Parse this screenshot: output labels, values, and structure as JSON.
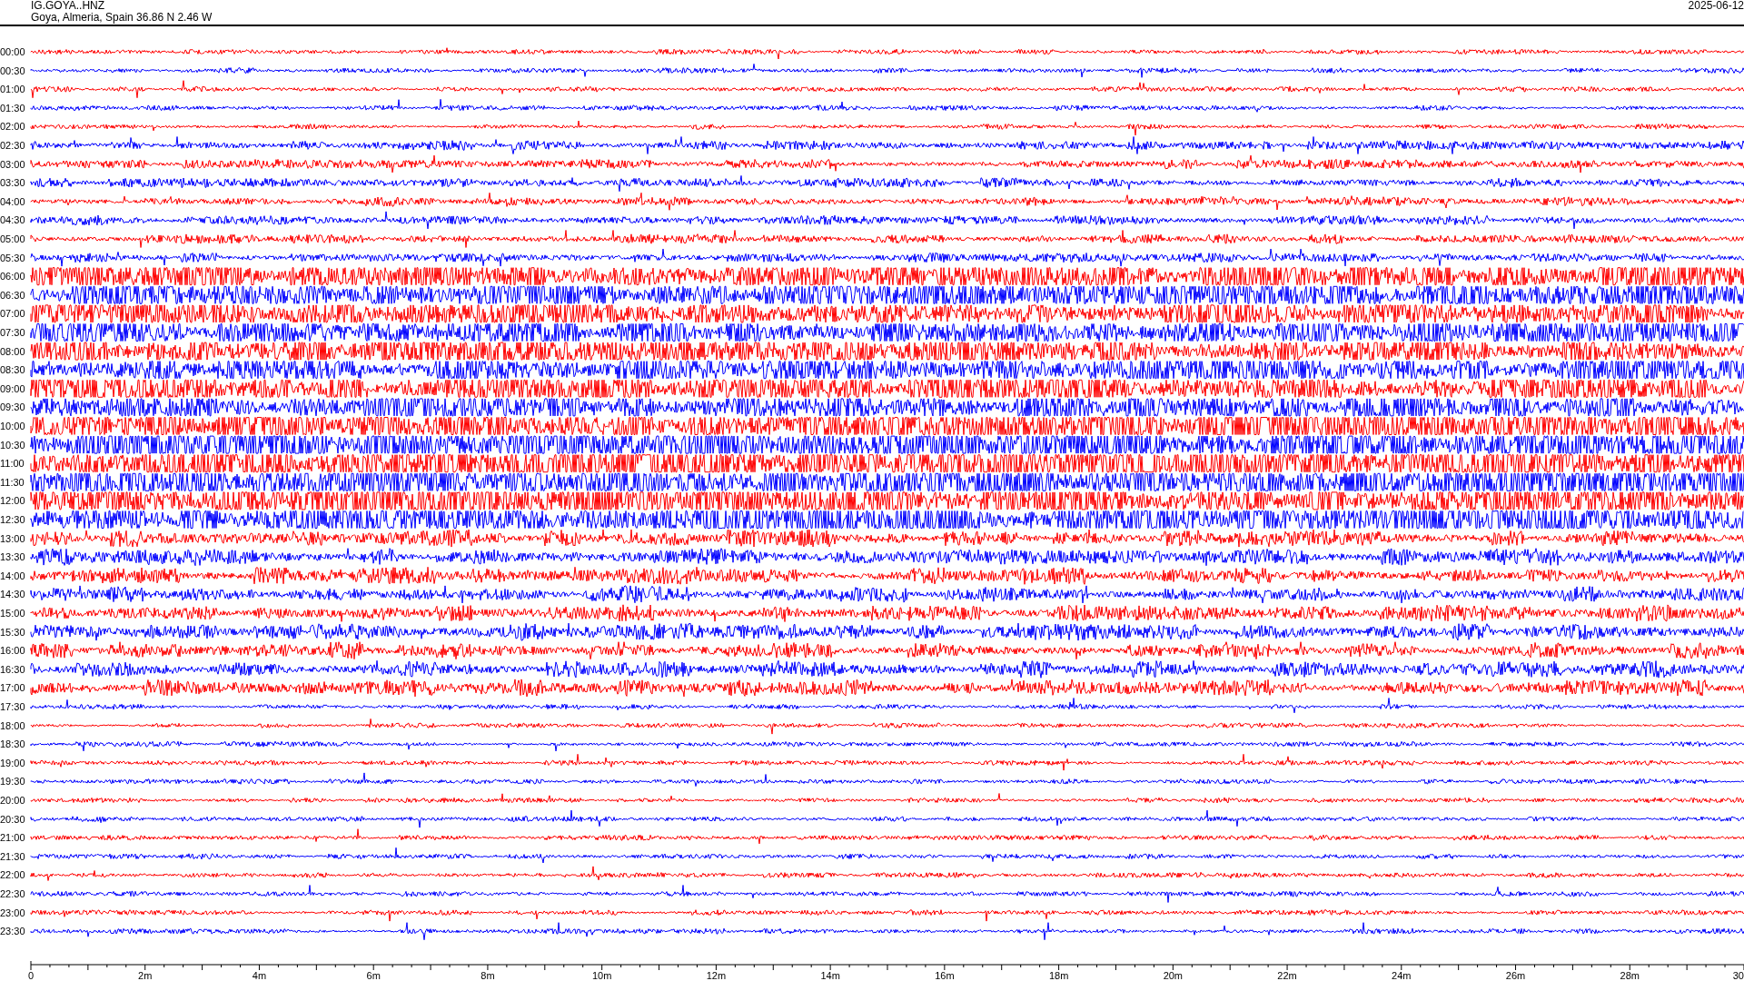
{
  "header": {
    "station": "IG.GOYA..HNZ",
    "location": "Goya, Almeria, Spain  36.86 N 2.46 W",
    "date": "2025-06-12"
  },
  "rows": [
    {
      "time": "00:00",
      "color": "#ff0000"
    },
    {
      "time": "00:30",
      "color": "#0000ff"
    },
    {
      "time": "01:00",
      "color": "#ff0000"
    },
    {
      "time": "01:30",
      "color": "#0000ff"
    },
    {
      "time": "02:00",
      "color": "#ff0000"
    },
    {
      "time": "02:30",
      "color": "#0000ff"
    },
    {
      "time": "03:00",
      "color": "#ff0000"
    },
    {
      "time": "03:30",
      "color": "#0000ff"
    },
    {
      "time": "04:00",
      "color": "#ff0000"
    },
    {
      "time": "04:30",
      "color": "#0000ff"
    },
    {
      "time": "05:00",
      "color": "#ff0000"
    },
    {
      "time": "05:30",
      "color": "#0000ff"
    },
    {
      "time": "06:00",
      "color": "#ff0000"
    },
    {
      "time": "06:30",
      "color": "#0000ff"
    },
    {
      "time": "07:00",
      "color": "#ff0000"
    },
    {
      "time": "07:30",
      "color": "#0000ff"
    },
    {
      "time": "08:00",
      "color": "#ff0000"
    },
    {
      "time": "08:30",
      "color": "#0000ff"
    },
    {
      "time": "09:00",
      "color": "#ff0000"
    },
    {
      "time": "09:30",
      "color": "#0000ff"
    },
    {
      "time": "10:00",
      "color": "#ff0000"
    },
    {
      "time": "10:30",
      "color": "#0000ff"
    },
    {
      "time": "11:00",
      "color": "#ff0000"
    },
    {
      "time": "11:30",
      "color": "#0000ff"
    },
    {
      "time": "12:00",
      "color": "#ff0000"
    },
    {
      "time": "12:30",
      "color": "#0000ff"
    },
    {
      "time": "13:00",
      "color": "#ff0000"
    },
    {
      "time": "13:30",
      "color": "#0000ff"
    },
    {
      "time": "14:00",
      "color": "#ff0000"
    },
    {
      "time": "14:30",
      "color": "#0000ff"
    },
    {
      "time": "15:00",
      "color": "#ff0000"
    },
    {
      "time": "15:30",
      "color": "#0000ff"
    },
    {
      "time": "16:00",
      "color": "#ff0000"
    },
    {
      "time": "16:30",
      "color": "#0000ff"
    },
    {
      "time": "17:00",
      "color": "#ff0000"
    },
    {
      "time": "17:30",
      "color": "#0000ff"
    },
    {
      "time": "18:00",
      "color": "#ff0000"
    },
    {
      "time": "18:30",
      "color": "#0000ff"
    },
    {
      "time": "19:00",
      "color": "#ff0000"
    },
    {
      "time": "19:30",
      "color": "#0000ff"
    },
    {
      "time": "20:00",
      "color": "#ff0000"
    },
    {
      "time": "20:30",
      "color": "#0000ff"
    },
    {
      "time": "21:00",
      "color": "#ff0000"
    },
    {
      "time": "21:30",
      "color": "#0000ff"
    },
    {
      "time": "22:00",
      "color": "#ff0000"
    },
    {
      "time": "22:30",
      "color": "#0000ff"
    },
    {
      "time": "23:00",
      "color": "#ff0000"
    },
    {
      "time": "23:30",
      "color": "#0000ff"
    }
  ],
  "x_axis": {
    "labels": [
      "0",
      "2m",
      "4m",
      "6m",
      "8m",
      "10m",
      "12m",
      "14m",
      "16m",
      "18m",
      "20m",
      "22m",
      "24m",
      "26m",
      "28m",
      "30"
    ]
  }
}
